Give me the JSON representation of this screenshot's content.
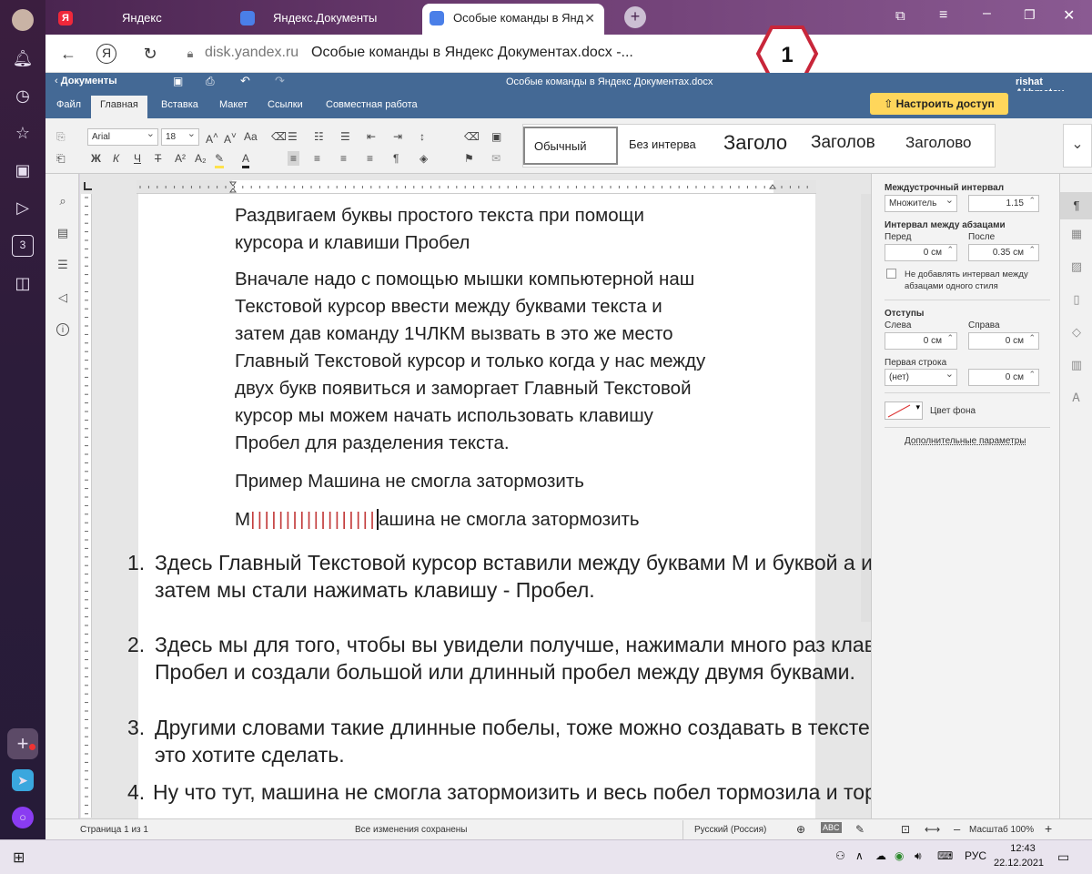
{
  "browser": {
    "tabs": [
      {
        "label": "Яндекс"
      },
      {
        "label": "Яндекс.Документы"
      },
      {
        "label": "Особые команды в Янд"
      }
    ],
    "new_tab_symbol": "+",
    "address": {
      "host": "disk.yandex.ru",
      "title": "Особые команды в Яндекс Документах.docx -..."
    },
    "badge_number": "1"
  },
  "doc_header": {
    "back_label": "Документы",
    "file_title": "Особые команды в Яндекс Документах.docx",
    "user": "rishat Akhmetov"
  },
  "ribbon": {
    "tabs": [
      "Файл",
      "Главная",
      "Вставка",
      "Макет",
      "Ссылки",
      "Совместная работа"
    ],
    "share_label": "Настроить доступ",
    "font_name": "Arial",
    "font_size": "18",
    "styles": [
      "Обычный",
      "Без интерва",
      "Заголо",
      "Заголов",
      "Заголово"
    ]
  },
  "document": {
    "p1_line1": "Раздвигаем буквы простого текста при помощи",
    "p1_line2": "курсора и клавиши Пробел",
    "p2_lines": [
      "Вначале надо с помощью мышки компьютерной наш",
      "Текстовой курсор ввести между буквами текста и",
      "затем дав команду 1ЧЛКМ вызвать в это же место",
      "Главный Текстовой курсор и только когда у нас между",
      "двух букв появиться и заморгает Главный Текстовой",
      "курсор мы можем начать использовать клавишу",
      "Пробел для разделения текста."
    ],
    "p3": "Пример Машина не смогла затормозить",
    "p4_start": "М",
    "p4_spaces": "||||||||||||||||||",
    "p4_end": "ашина не смогла затормозить"
  },
  "notes": [
    {
      "num": "1.",
      "line1": "Здесь Главный Текстовой  курсор вставили между буквами  М и буквой  а  и  только",
      "line2": "затем мы стали нажимать клавишу - Пробел."
    },
    {
      "num": "2.",
      "line1": "Здесь мы для того, чтобы вы увидели получше, нажимали много раз клавишу",
      "line2": "Пробел и создали большой или длинный пробел между двумя буквами."
    },
    {
      "num": "3.",
      "line1": "Другими словами такие длинные побелы, тоже можно создавать в тексте, если вы",
      "line2": "это хотите сделать."
    },
    {
      "num": "4.",
      "line1": "Ну что тут, машина не смогла затормоизить и весь побел тормозила и тормозила.",
      "line2": ""
    }
  ],
  "paragraph_panel": {
    "line_spacing_label": "Междустрочный интервал",
    "line_spacing_mode": "Множитель",
    "line_spacing_value": "1.15",
    "para_spacing_label": "Интервал между абзацами",
    "before_label": "Перед",
    "after_label": "После",
    "before_value": "0 см",
    "after_value": "0.35 см",
    "no_spacing_label_1": "Не добавлять интервал между",
    "no_spacing_label_2": "абзацами одного стиля",
    "indents_label": "Отступы",
    "left_label": "Слева",
    "right_label": "Справа",
    "left_value": "0 см",
    "right_value": "0 см",
    "first_line_label": "Первая строка",
    "first_line_mode": "(нет)",
    "first_line_value": "0 см",
    "bg_color_label": "Цвет фона",
    "advanced_label": "Дополнительные параметры"
  },
  "statusbar": {
    "page": "Страница 1 из 1",
    "saved": "Все изменения сохранены",
    "language": "Русский (Россия)",
    "zoom": "Масштаб 100%"
  },
  "taskbar": {
    "lang": "РУС",
    "time": "12:43",
    "date": "22.12.2021"
  },
  "colors": {
    "doc_blue": "#446995",
    "share_yellow": "#ffd65b",
    "space_marks": "#c33c3c",
    "badge_red": "#c8263a"
  }
}
